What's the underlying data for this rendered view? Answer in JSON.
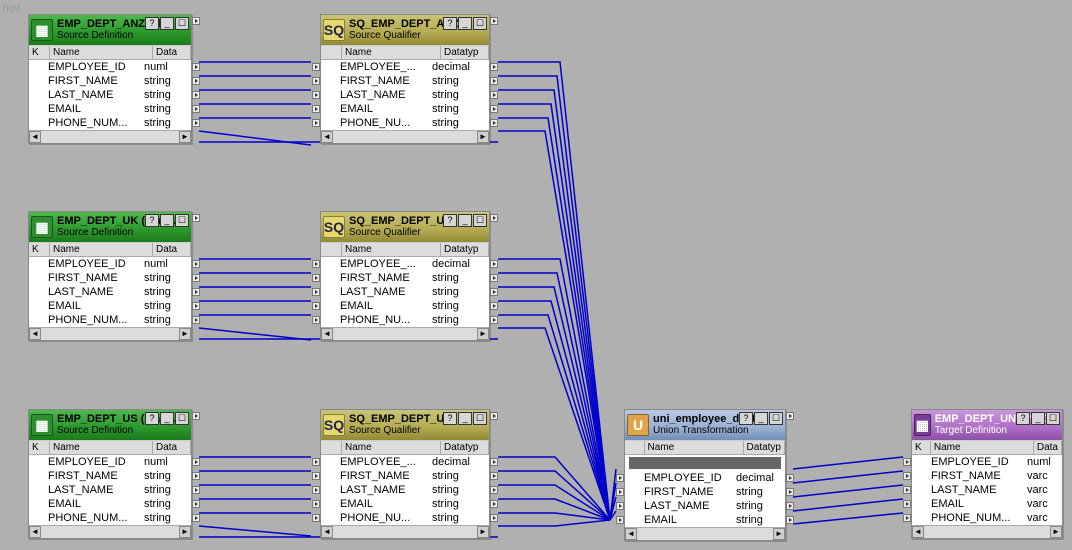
{
  "watermark": "ner",
  "winbuttons": {
    "help": "?",
    "min": "_",
    "close": "☐"
  },
  "hdr": {
    "k": "K",
    "name": "Name",
    "data": "Data",
    "datatype": "Datatyp"
  },
  "scroll": {
    "left": "◄",
    "right": "►"
  },
  "boxes": {
    "src_anz": {
      "title": "EMP_DEPT_ANZ (Flat…",
      "sub": "Source Definition",
      "rows": [
        [
          "EMPLOYEE_ID",
          "numl"
        ],
        [
          "FIRST_NAME",
          "string"
        ],
        [
          "LAST_NAME",
          "string"
        ],
        [
          "EMAIL",
          "string"
        ],
        [
          "PHONE_NUM...",
          "string"
        ]
      ]
    },
    "sq_anz": {
      "title": "SQ_EMP_DEPT_ANZ",
      "sub": "Source Qualifier",
      "rows": [
        [
          "EMPLOYEE_...",
          "decimal"
        ],
        [
          "FIRST_NAME",
          "string"
        ],
        [
          "LAST_NAME",
          "string"
        ],
        [
          "EMAIL",
          "string"
        ],
        [
          "PHONE_NU...",
          "string"
        ]
      ]
    },
    "src_uk": {
      "title": "EMP_DEPT_UK (FlatF...",
      "sub": "Source Definition",
      "rows": [
        [
          "EMPLOYEE_ID",
          "numl"
        ],
        [
          "FIRST_NAME",
          "string"
        ],
        [
          "LAST_NAME",
          "string"
        ],
        [
          "EMAIL",
          "string"
        ],
        [
          "PHONE_NUM...",
          "string"
        ]
      ]
    },
    "sq_uk": {
      "title": "SQ_EMP_DEPT_UK",
      "sub": "Source Qualifier",
      "rows": [
        [
          "EMPLOYEE_...",
          "decimal"
        ],
        [
          "FIRST_NAME",
          "string"
        ],
        [
          "LAST_NAME",
          "string"
        ],
        [
          "EMAIL",
          "string"
        ],
        [
          "PHONE_NU...",
          "string"
        ]
      ]
    },
    "src_us": {
      "title": "EMP_DEPT_US (FlatF...",
      "sub": "Source Definition",
      "rows": [
        [
          "EMPLOYEE_ID",
          "numl"
        ],
        [
          "FIRST_NAME",
          "string"
        ],
        [
          "LAST_NAME",
          "string"
        ],
        [
          "EMAIL",
          "string"
        ],
        [
          "PHONE_NUM...",
          "string"
        ]
      ]
    },
    "sq_us": {
      "title": "SQ_EMP_DEPT_US",
      "sub": "Source Qualifier",
      "rows": [
        [
          "EMPLOYEE_...",
          "decimal"
        ],
        [
          "FIRST_NAME",
          "string"
        ],
        [
          "LAST_NAME",
          "string"
        ],
        [
          "EMAIL",
          "string"
        ],
        [
          "PHONE_NU...",
          "string"
        ]
      ]
    },
    "union": {
      "title": "uni_employee_dept",
      "sub": "Union Transformation",
      "rows": [
        [
          "EMPLOYEE_ID",
          "decimal"
        ],
        [
          "FIRST_NAME",
          "string"
        ],
        [
          "LAST_NAME",
          "string"
        ],
        [
          "EMAIL",
          "string"
        ]
      ]
    },
    "target": {
      "title": "EMP_DEPT_UNION (O...",
      "sub": "Target Definition",
      "rows": [
        [
          "EMPLOYEE_ID",
          "numl"
        ],
        [
          "FIRST_NAME",
          "varc"
        ],
        [
          "LAST_NAME",
          "varc"
        ],
        [
          "EMAIL",
          "varc"
        ],
        [
          "PHONE_NUM...",
          "varc"
        ]
      ]
    }
  }
}
